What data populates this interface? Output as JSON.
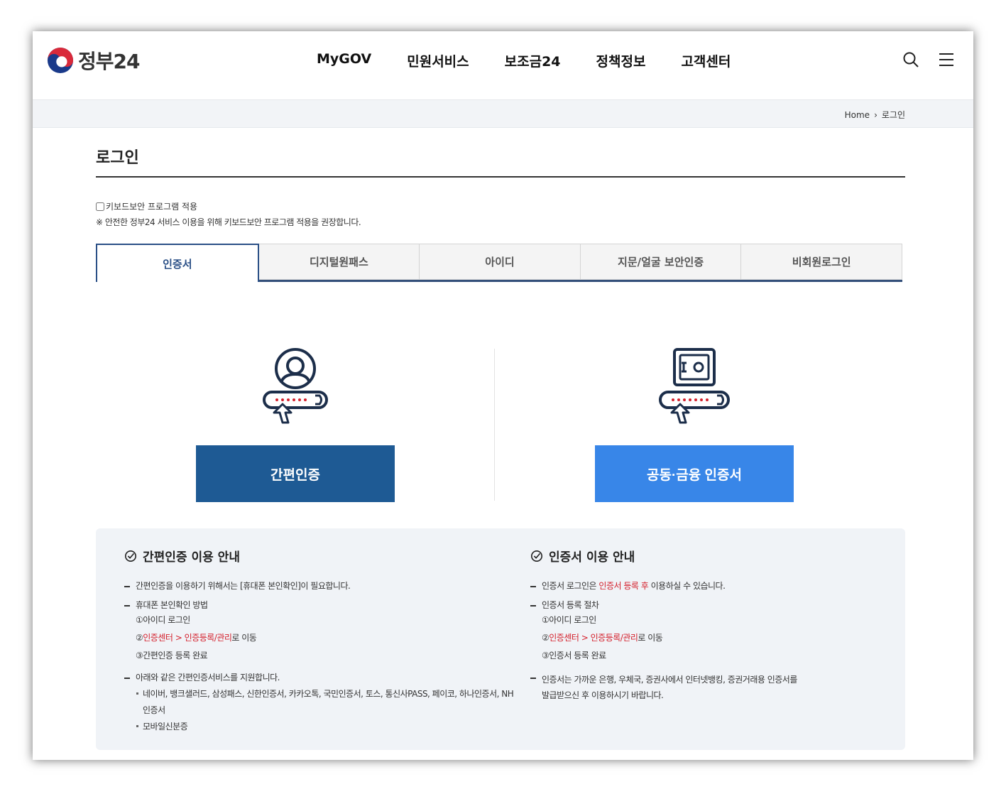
{
  "header": {
    "logo_text": "정부24",
    "nav": [
      "MyGOV",
      "민원서비스",
      "보조금24",
      "정책정보",
      "고객센터"
    ]
  },
  "breadcrumb": {
    "home": "Home",
    "current": "로그인"
  },
  "page_title": "로그인",
  "keyboard": {
    "label": "키보드보안 프로그램 적용",
    "checked": false,
    "note": "※ 안전한 정부24 서비스 이용을 위해 키보드보안 프로그램 적용을 권장합니다."
  },
  "tabs": [
    {
      "label": "인증서",
      "active": true
    },
    {
      "label": "디지털원패스",
      "active": false
    },
    {
      "label": "아이디",
      "active": false
    },
    {
      "label": "지문/얼굴 보안인증",
      "active": false
    },
    {
      "label": "비회원로그인",
      "active": false
    }
  ],
  "buttons": {
    "simple_auth": "간편인증",
    "cert": "공동·금융 인증서"
  },
  "colors": {
    "primary_dark": "#1e5a94",
    "primary_light": "#3886e8",
    "accent_red": "#d4202c",
    "tab_active": "#2a4f86"
  },
  "info_left": {
    "title": "간편인증 이용 안내",
    "item1": "간편인증을 이용하기 위해서는 [휴대폰 본인확인]이 필요합니다.",
    "item2": "휴대폰 본인확인 방법",
    "step1": "①아이디 로그인",
    "step2_prefix": "②",
    "step2_red": "인증센터 > 인증등록/관리",
    "step2_suffix": "로 이동",
    "step3": "③간편인증 등록 완료",
    "item3": "아래와 같은 간편인증서비스를 지원합니다.",
    "services": "네이버, 뱅크샐러드, 삼성패스, 신한인증서, 카카오톡, 국민인증서, 토스, 통신사PASS, 페이코, 하나인증서, NH인증서",
    "mobile_id": "모바일신분증"
  },
  "info_right": {
    "title": "인증서 이용 안내",
    "item1_prefix": "인증서 로그인은 ",
    "item1_red": "인증서 등록 후",
    "item1_suffix": " 이용하실 수 있습니다.",
    "item2": "인증서 등록 절차",
    "step1": "①아이디 로그인",
    "step2_prefix": "②",
    "step2_red": "인증센터 > 인증등록/관리",
    "step2_suffix": "로 이동",
    "step3": "③인증서 등록 완료",
    "item3": "인증서는 가까운 은행, 우체국, 증권사에서 인터넷뱅킹, 증권거래용 인증서를 발급받으신 후 이용하시기 바랍니다."
  }
}
